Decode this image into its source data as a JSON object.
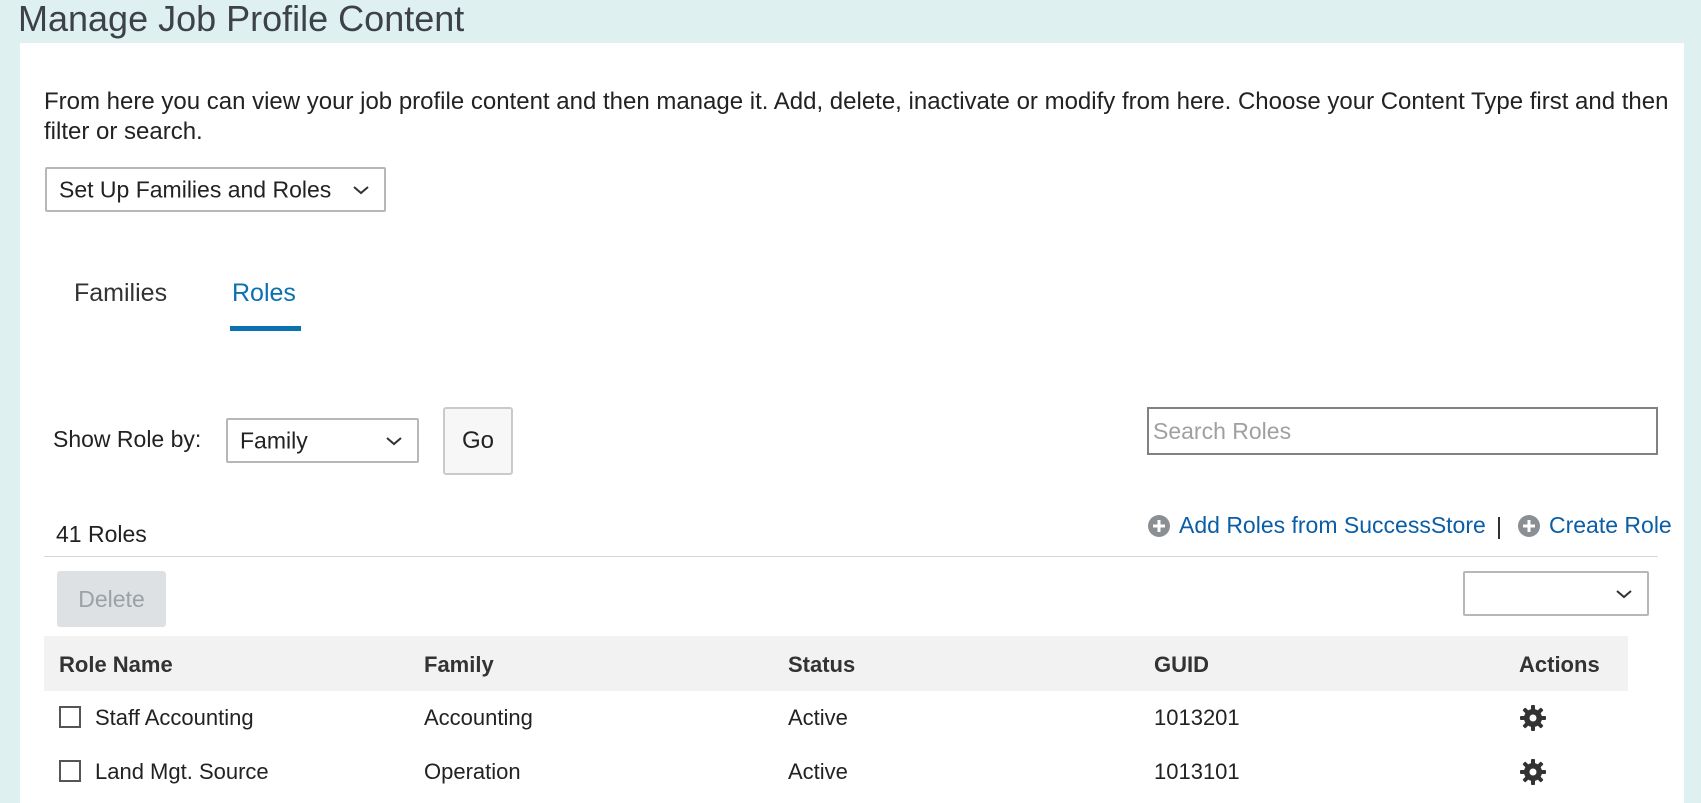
{
  "page": {
    "title": "Manage Job Profile Content",
    "intro": "From here you can view your job profile content and then manage it. Add, delete, inactivate or modify from here. Choose your Content Type first and then filter or search."
  },
  "content_type_select": {
    "value": "Set Up Families and Roles",
    "icon": "chevron-down-icon"
  },
  "tabs": [
    {
      "label": "Families",
      "active": false
    },
    {
      "label": "Roles",
      "active": true
    }
  ],
  "filter": {
    "label": "Show Role by:",
    "select_value": "Family",
    "go_label": "Go",
    "search_placeholder": "Search Roles"
  },
  "summary": {
    "count_text": "41 Roles"
  },
  "actions": {
    "add_from_store": "Add Roles from SuccessStore",
    "separator": "|",
    "create_role": "Create Role",
    "delete_label": "Delete",
    "bulk_select_value": ""
  },
  "table": {
    "columns": [
      "Role Name",
      "Family",
      "Status",
      "GUID",
      "Actions"
    ],
    "rows": [
      {
        "role_name": "Staff Accounting",
        "family": "Accounting",
        "status": "Active",
        "guid": "1013201",
        "action_icon": "gear-icon"
      },
      {
        "role_name": "Land Mgt. Source",
        "family": "Operation",
        "status": "Active",
        "guid": "1013101",
        "action_icon": "gear-icon"
      }
    ]
  },
  "colors": {
    "background": "#dff0f0",
    "link": "#0b5ea6",
    "tab_active": "#0a72b0",
    "header_bg": "#f2f2f2"
  }
}
